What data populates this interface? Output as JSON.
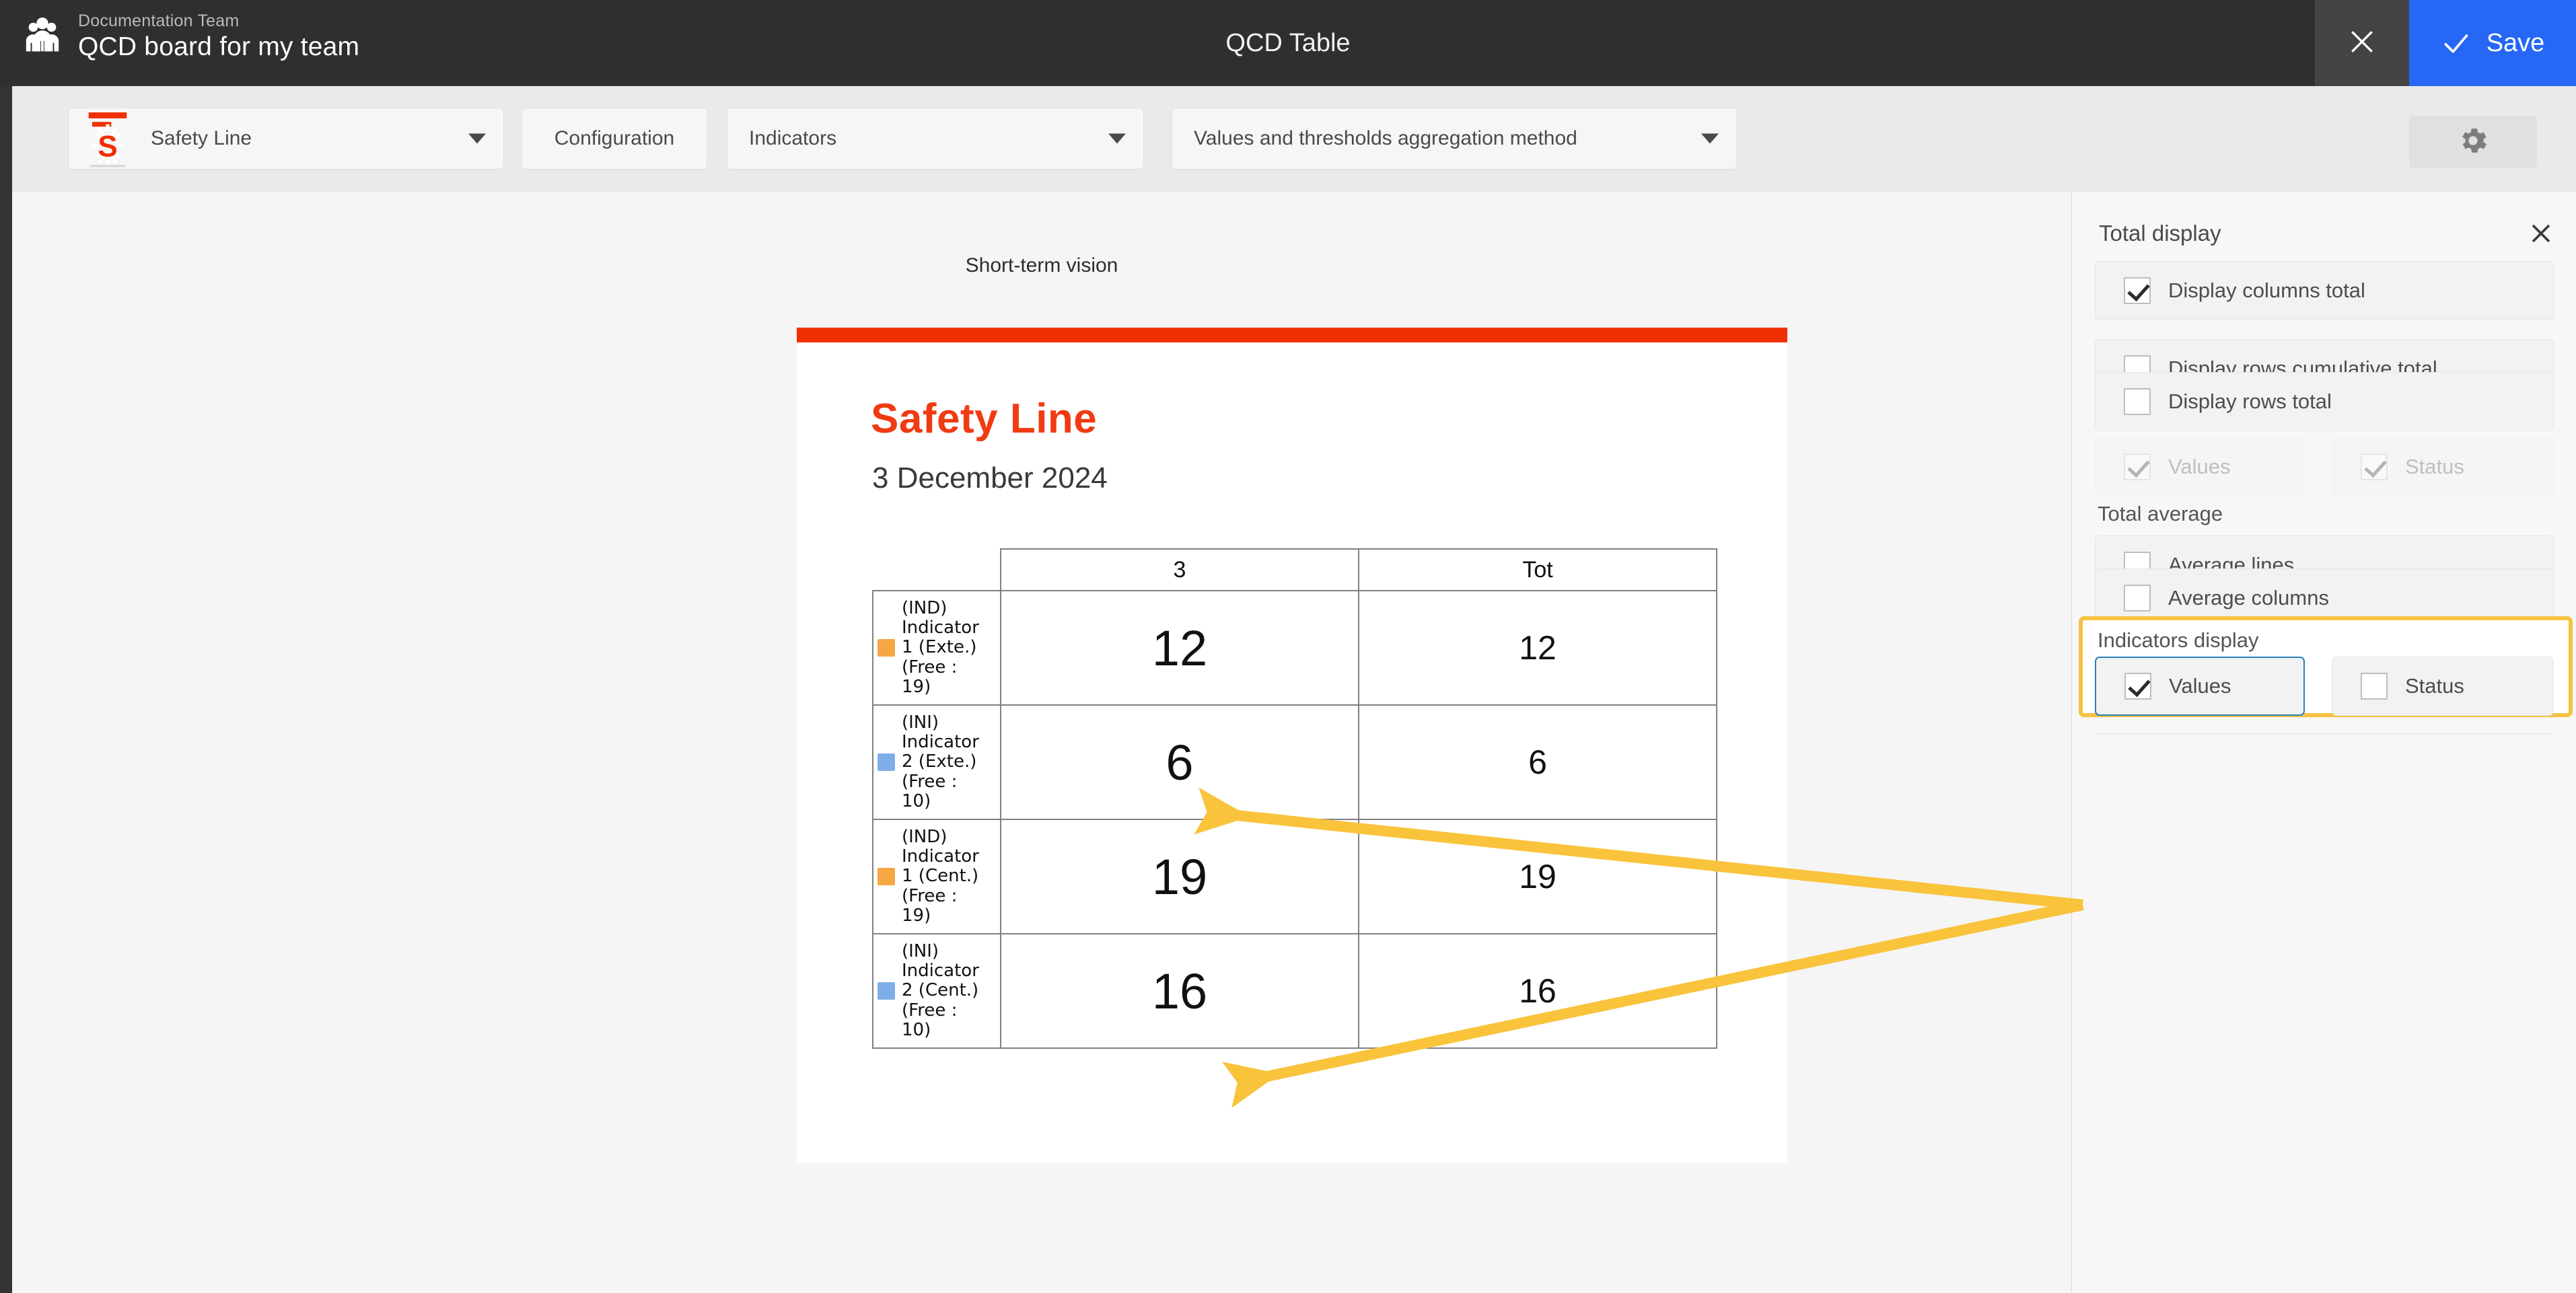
{
  "header": {
    "team": "Documentation Team",
    "board_title": "QCD board for my team",
    "center_title": "QCD Table",
    "close_icon": "close-icon",
    "save_label": "Save",
    "save_icon": "check-icon",
    "people_icon": "people-group-icon",
    "bg_color": "#2f2f2f",
    "save_color": "#2667f5"
  },
  "toolbar": {
    "line_select": "Safety Line",
    "line_icon": "safety-line-sunburst-icon",
    "configuration_button": "Configuration",
    "indicators_select": "Indicators",
    "aggregation_select": "Values and thresholds aggregation method",
    "settings_icon": "gear-icon",
    "caret_icon": "chevron-down-icon"
  },
  "canvas": {
    "vision_label": "Short-term vision"
  },
  "report": {
    "accent_color": "#f03000",
    "title": "Safety Line",
    "title_color": "#f03b12",
    "date": "3 December 2024"
  },
  "chart_data": {
    "type": "table",
    "title": "Safety Line",
    "subtitle": "3 December 2024",
    "columns": [
      "",
      "3",
      "Tot"
    ],
    "rows": [
      {
        "swatch_color": "#f5a742",
        "label": "(IND) Indicator 1 (Exte.) (Free : 19)",
        "label_lines": [
          "(IND)",
          "Indicator",
          "1 (Exte.)",
          "(Free :",
          "19)"
        ],
        "value": 12,
        "total": 12
      },
      {
        "swatch_color": "#7eaee8",
        "label": "(INI) Indicator 2 (Exte.) (Free : 10)",
        "label_lines": [
          "(INI)",
          "Indicator",
          "2 (Exte.)",
          "(Free :",
          "10)"
        ],
        "value": 6,
        "total": 6
      },
      {
        "swatch_color": "#f5a742",
        "label": "(IND) Indicator 1 (Cent.) (Free : 19)",
        "label_lines": [
          "(IND)",
          "Indicator",
          "1 (Cent.)",
          "(Free :",
          "19)"
        ],
        "value": 19,
        "total": 19
      },
      {
        "swatch_color": "#7eaee8",
        "label": "(INI) Indicator 2 (Cent.) (Free : 10)",
        "label_lines": [
          "(INI)",
          "Indicator",
          "2 (Cent.)",
          "(Free :",
          "10)"
        ],
        "value": 16,
        "total": 16
      }
    ]
  },
  "panel": {
    "title": "Total display",
    "close_icon": "close-icon",
    "total_display": [
      {
        "label": "Display columns total",
        "checked": true,
        "disabled": false
      },
      {
        "label": "Display rows cumulative total",
        "checked": false,
        "disabled": false
      },
      {
        "label": "Display rows total",
        "checked": false,
        "disabled": false
      },
      {
        "label": "Values",
        "checked": true,
        "disabled": true
      },
      {
        "label": "Status",
        "checked": true,
        "disabled": true
      }
    ],
    "total_average_heading": "Total average",
    "total_average": [
      {
        "label": "Average lines",
        "checked": false,
        "disabled": false
      },
      {
        "label": "Average columns",
        "checked": false,
        "disabled": false
      }
    ],
    "indicators_display_heading": "Indicators display",
    "indicators_display": [
      {
        "label": "Values",
        "checked": true,
        "selected": true
      },
      {
        "label": "Status",
        "checked": false,
        "selected": false
      }
    ]
  },
  "annotations": {
    "highlight_color": "#f5c242",
    "arrow_color": "#f9c33c",
    "arrow_count": 2,
    "arrow_targets": [
      "cell-value-6",
      "cell-value-16"
    ]
  }
}
